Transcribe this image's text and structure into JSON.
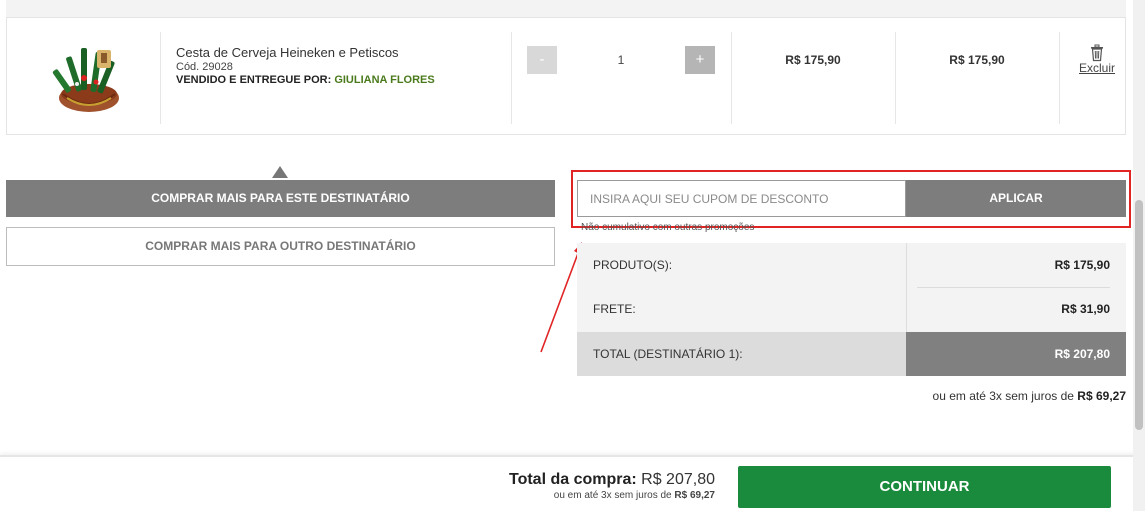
{
  "product": {
    "name": "Cesta de Cerveja Heineken e Petiscos",
    "code": "Cód. 29028",
    "seller_label": "VENDIDO E ENTREGUE POR:",
    "seller_name": "GIULIANA FLORES",
    "image_icon": "beer-basket-image",
    "quantity": "1",
    "qty_minus_label": "-",
    "qty_plus_label": "+",
    "unit_price": "R$ 175,90",
    "total_price": "R$ 175,90",
    "remove_label": "Excluir",
    "remove_icon": "trash-icon"
  },
  "actions": {
    "buy_more_same": "COMPRAR MAIS PARA ESTE DESTINATÁRIO",
    "buy_more_other": "COMPRAR MAIS PARA OUTRO DESTINATÁRIO"
  },
  "coupon": {
    "placeholder": "INSIRA AQUI SEU CUPOM DE DESCONTO",
    "apply_label": "APLICAR",
    "note": "Não cumulativo com outras promoções",
    "highlight_color": "#e02424"
  },
  "summary": {
    "products_label": "PRODUTO(S):",
    "products_value": "R$ 175,90",
    "shipping_label": "FRETE:",
    "shipping_value": "R$ 31,90",
    "total_label": "TOTAL (DESTINATÁRIO 1):",
    "total_value": "R$ 207,80",
    "installments_text": "ou em até 3x sem juros de",
    "installments_value": "R$ 69,27"
  },
  "footer": {
    "total_label": "Total da compra:",
    "total_value": "R$ 207,80",
    "installments_text": "ou em até 3x sem juros de",
    "installments_value": "R$ 69,27",
    "continue_label": "CONTINUAR",
    "continue_color": "#1a8a3c"
  }
}
